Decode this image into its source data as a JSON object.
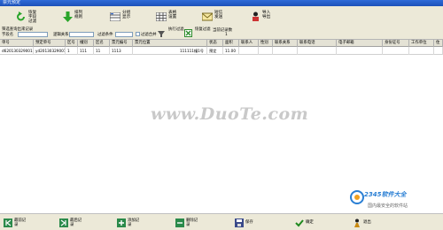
{
  "window": {
    "title": "票元预定"
  },
  "toolbar": {
    "buttons": [
      {
        "line1": "恢复",
        "line2": "字段",
        "line3": "过滤"
      },
      {
        "line1": "排列",
        "line2": "规则",
        "line3": ""
      },
      {
        "line1": "分组",
        "line2": "显示",
        "line3": ""
      },
      {
        "line1": "表格",
        "line2": "设置",
        "line3": ""
      },
      {
        "line1": "短信",
        "line2": "发送",
        "line3": ""
      },
      {
        "line1": "导入",
        "line2": "导出",
        "line3": ""
      }
    ]
  },
  "filter": {
    "hint": "筛选查询出来记录",
    "field_label": "字段名",
    "logic_label": "逻辑关系",
    "condition_label": "过滤条件",
    "combine_label": "过滤合并",
    "run_label": "执行过滤",
    "restore_label": "恢复过滤",
    "count_label": "当前记录数",
    "count_value": "1"
  },
  "table": {
    "columns": [
      "单号",
      "预定单号",
      "区号",
      "幢别",
      "区名",
      "票元编号",
      "票元位置",
      "状态",
      "面积",
      "联系人",
      "性别",
      "联系关系",
      "联系电话",
      "电子邮箱",
      "身份证号",
      "工作单位",
      "住"
    ],
    "rows": [
      [
        "d620130329001",
        "yd20130329001",
        "1",
        "111",
        "11",
        "1113",
        "111111幢1号",
        "预定",
        "11.00",
        "",
        "",
        "",
        "",
        "",
        "",
        "",
        ""
      ]
    ]
  },
  "watermark": "www.DuoTe.com",
  "logo": {
    "name": "2345软件大全",
    "sub": "国内最安全的软件站"
  },
  "bottombar": {
    "buttons": [
      {
        "line1": "最前记",
        "line2": "录"
      },
      {
        "line1": "最后记",
        "line2": "录"
      },
      {
        "line1": "添加记",
        "line2": "录"
      },
      {
        "line1": "删除记",
        "line2": "录"
      },
      {
        "line1": "保存",
        "line2": ""
      },
      {
        "line1": "确定",
        "line2": ""
      },
      {
        "line1": "退出",
        "line2": ""
      }
    ]
  }
}
